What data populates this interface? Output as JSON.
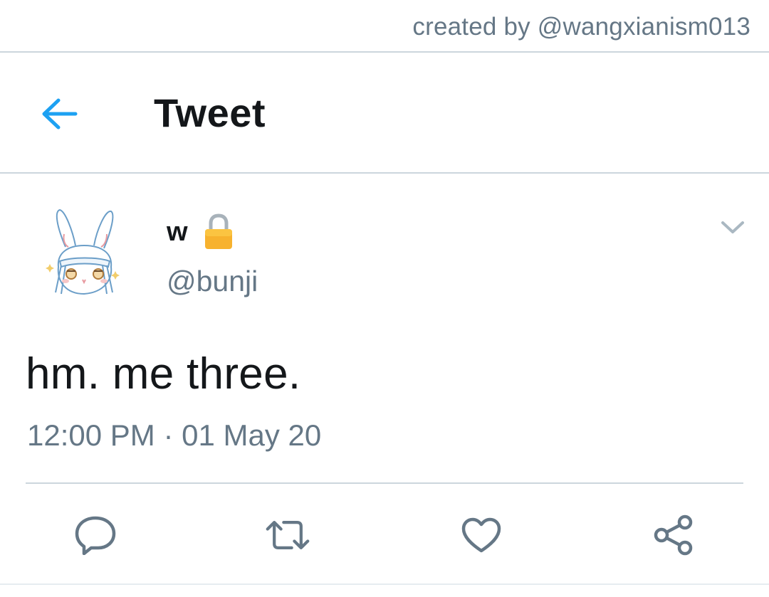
{
  "credit": {
    "text": "created by @wangxianism013"
  },
  "header": {
    "title": "Tweet",
    "back_icon": "arrow-left-icon",
    "accent_color": "#1da1f2"
  },
  "tweet": {
    "author": {
      "display_name": "w",
      "handle": "@bunji",
      "protected_icon": "lock-icon",
      "avatar_icon": "bunny-avatar"
    },
    "more_icon": "chevron-down-icon",
    "text": "hm. me three.",
    "timestamp": "12:00 PM · 01 May 20"
  },
  "actions": [
    {
      "icon": "reply-icon"
    },
    {
      "icon": "retweet-icon"
    },
    {
      "icon": "like-icon"
    },
    {
      "icon": "share-icon"
    }
  ],
  "colors": {
    "primary_text": "#14171a",
    "secondary_text": "#657786",
    "divider": "#ccd6dd"
  }
}
